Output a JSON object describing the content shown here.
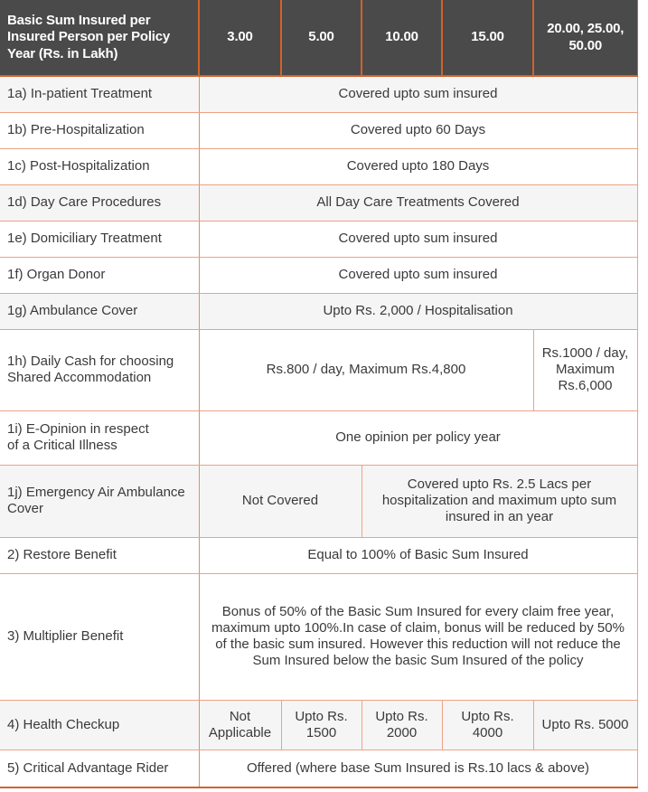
{
  "table": {
    "header": {
      "row_label": "Basic Sum Insured per Insured Person per Policy Year (Rs. in Lakh)",
      "columns": [
        "3.00",
        "5.00",
        "10.00",
        "15.00",
        "20.00, 25.00, 50.00"
      ]
    },
    "colors": {
      "header_bg": "#4a4a4a",
      "header_text": "#ffffff",
      "header_divider": "#d2622a",
      "body_border": "#eda285",
      "row_shade": "#f5f5f5",
      "row_plain": "#ffffff",
      "body_text": "#3a3a3a"
    },
    "rows": [
      {
        "label": "1a) In-patient Treatment",
        "shade": true,
        "cells": [
          {
            "text": "Covered upto sum insured",
            "span": 5
          }
        ]
      },
      {
        "label": "1b) Pre-Hospitalization",
        "shade": false,
        "cells": [
          {
            "text": "Covered upto 60 Days",
            "span": 5
          }
        ]
      },
      {
        "label": "1c) Post-Hospitalization",
        "shade": false,
        "cells": [
          {
            "text": "Covered upto 180 Days",
            "span": 5
          }
        ]
      },
      {
        "label": "1d) Day Care Procedures",
        "shade": true,
        "cells": [
          {
            "text": "All Day Care Treatments Covered",
            "span": 5
          }
        ]
      },
      {
        "label": "1e) Domiciliary Treatment",
        "shade": false,
        "cells": [
          {
            "text": "Covered upto sum insured",
            "span": 5
          }
        ]
      },
      {
        "label": "1f) Organ Donor",
        "shade": false,
        "cells": [
          {
            "text": "Covered upto sum insured",
            "span": 5
          }
        ]
      },
      {
        "label": "1g) Ambulance Cover",
        "shade": true,
        "cells": [
          {
            "text": "Upto Rs. 2,000 / Hospitalisation",
            "span": 5
          }
        ]
      },
      {
        "label": "1h)  Daily Cash for choosing Shared Accommodation",
        "shade": false,
        "cells": [
          {
            "text": "Rs.800 / day, Maximum Rs.4,800",
            "span": 4
          },
          {
            "text": "Rs.1000 / day, Maximum Rs.6,000",
            "span": 1
          }
        ]
      },
      {
        "label": "1i) E-Opinion in respect\n of a Critical Illness",
        "shade": false,
        "cells": [
          {
            "text": "One opinion per policy year",
            "span": 5
          }
        ]
      },
      {
        "label": "1j) Emergency Air Ambulance Cover",
        "shade": true,
        "cells": [
          {
            "text": "Not Covered",
            "span": 2
          },
          {
            "text": "Covered upto Rs. 2.5 Lacs per hospitalization and maximum upto sum insured in an year",
            "span": 3
          }
        ]
      },
      {
        "label": "2) Restore Benefit",
        "shade": false,
        "cells": [
          {
            "text": "Equal to 100% of Basic Sum Insured",
            "span": 5
          }
        ]
      },
      {
        "label": "3) Multiplier Benefit",
        "shade": false,
        "cells": [
          {
            "text": "Bonus of 50% of the Basic Sum Insured for every claim free year, maximum upto 100%.In case of claim, bonus will be reduced by 50% of the basic sum insured. However this reduction will not reduce the Sum Insured below the basic Sum Insured of the policy",
            "span": 5
          }
        ]
      },
      {
        "label": "4) Health Checkup",
        "shade": true,
        "cells": [
          {
            "text": "Not Applicable",
            "span": 1
          },
          {
            "text": "Upto Rs. 1500",
            "span": 1
          },
          {
            "text": "Upto Rs. 2000",
            "span": 1
          },
          {
            "text": "Upto Rs. 4000",
            "span": 1
          },
          {
            "text": "Upto Rs. 5000",
            "span": 1
          }
        ]
      },
      {
        "label": "5) Critical Advantage Rider",
        "shade": false,
        "cells": [
          {
            "text": "Offered (where base Sum Insured is Rs.10 lacs & above)",
            "span": 5
          }
        ]
      }
    ]
  }
}
